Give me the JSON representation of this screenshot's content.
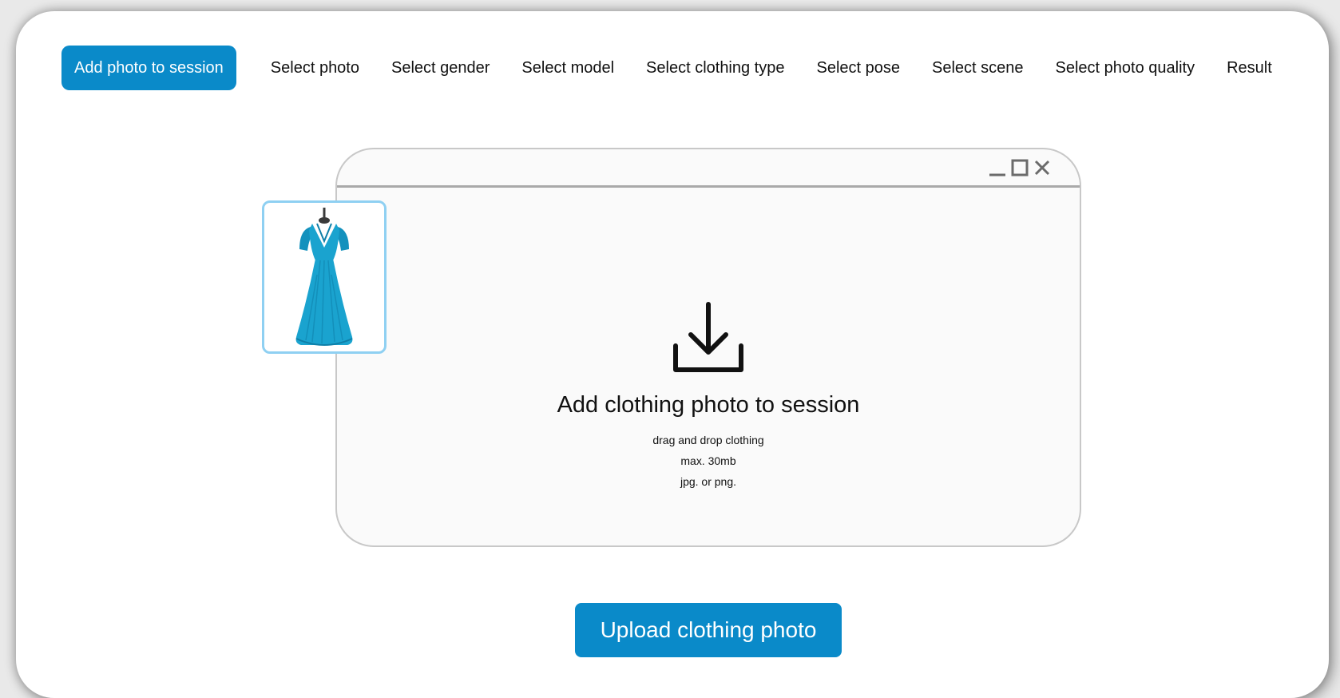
{
  "steps": [
    {
      "label": "Add photo to session",
      "active": true
    },
    {
      "label": "Select photo"
    },
    {
      "label": "Select gender"
    },
    {
      "label": "Select model"
    },
    {
      "label": "Select clothing type"
    },
    {
      "label": "Select pose"
    },
    {
      "label": "Select scene"
    },
    {
      "label": "Select photo quality"
    },
    {
      "label": "Result"
    }
  ],
  "dropzone": {
    "title": "Add clothing photo to session",
    "hint_1": "drag and drop clothing",
    "hint_2": "max. 30mb",
    "hint_3": "jpg. or png.",
    "icon": "download-icon"
  },
  "window_controls": [
    "minimize-icon",
    "maximize-icon",
    "close-icon"
  ],
  "thumbnail": {
    "icon": "dress-image"
  },
  "upload_button": {
    "label": "Upload clothing photo"
  },
  "colors": {
    "accent": "#0a8ac9",
    "thumb_border": "#8fd0f2",
    "dress": "#1aa3cf"
  }
}
